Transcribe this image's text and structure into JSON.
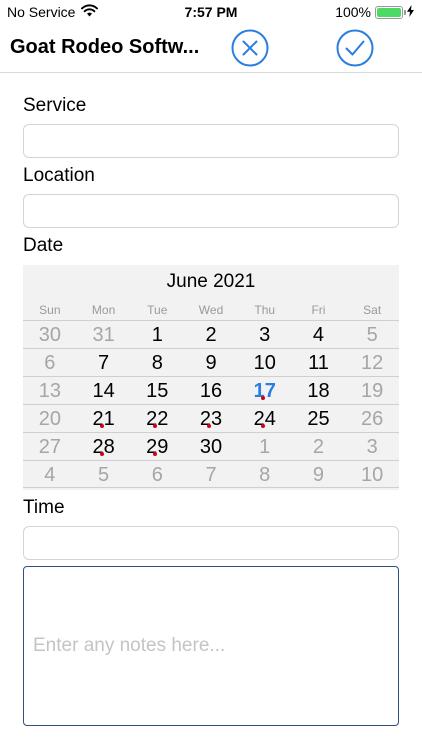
{
  "status_bar": {
    "carrier": "No Service",
    "time": "7:57 PM",
    "battery": "100%",
    "battery_level": 1.0,
    "battery_color": "#4cd964"
  },
  "nav": {
    "title": "Goat Rodeo Softw...",
    "cancel_icon": "x-circle-icon",
    "done_icon": "checkmark-circle-icon",
    "accent_color": "#2a7de1"
  },
  "form": {
    "service_label": "Service",
    "service_value": "",
    "location_label": "Location",
    "location_value": "",
    "date_label": "Date",
    "time_label": "Time",
    "time_value": "",
    "notes_placeholder": "Enter any notes here..."
  },
  "calendar": {
    "month_title": "June 2021",
    "weekdays": [
      "Sun",
      "Mon",
      "Tue",
      "Wed",
      "Thu",
      "Fri",
      "Sat"
    ],
    "today_color": "#2a7de1",
    "event_dot_color": "#d0021b",
    "weeks": [
      [
        {
          "d": "30",
          "muted": true
        },
        {
          "d": "31",
          "muted": true
        },
        {
          "d": "1"
        },
        {
          "d": "2"
        },
        {
          "d": "3"
        },
        {
          "d": "4"
        },
        {
          "d": "5",
          "muted": true
        }
      ],
      [
        {
          "d": "6",
          "muted": true
        },
        {
          "d": "7"
        },
        {
          "d": "8"
        },
        {
          "d": "9"
        },
        {
          "d": "10"
        },
        {
          "d": "11"
        },
        {
          "d": "12",
          "muted": true
        }
      ],
      [
        {
          "d": "13",
          "muted": true
        },
        {
          "d": "14"
        },
        {
          "d": "15"
        },
        {
          "d": "16"
        },
        {
          "d": "17",
          "today": true,
          "dot": true
        },
        {
          "d": "18"
        },
        {
          "d": "19",
          "muted": true
        }
      ],
      [
        {
          "d": "20",
          "muted": true
        },
        {
          "d": "21",
          "dot": true
        },
        {
          "d": "22",
          "dot": true
        },
        {
          "d": "23",
          "dot": true
        },
        {
          "d": "24",
          "dot": true
        },
        {
          "d": "25"
        },
        {
          "d": "26",
          "muted": true
        }
      ],
      [
        {
          "d": "27",
          "muted": true
        },
        {
          "d": "28",
          "dot": true
        },
        {
          "d": "29",
          "dot": true
        },
        {
          "d": "30"
        },
        {
          "d": "1",
          "muted": true
        },
        {
          "d": "2",
          "muted": true
        },
        {
          "d": "3",
          "muted": true
        }
      ],
      [
        {
          "d": "4",
          "muted": true
        },
        {
          "d": "5",
          "muted": true
        },
        {
          "d": "6",
          "muted": true
        },
        {
          "d": "7",
          "muted": true
        },
        {
          "d": "8",
          "muted": true
        },
        {
          "d": "9",
          "muted": true
        },
        {
          "d": "10",
          "muted": true
        }
      ]
    ]
  }
}
